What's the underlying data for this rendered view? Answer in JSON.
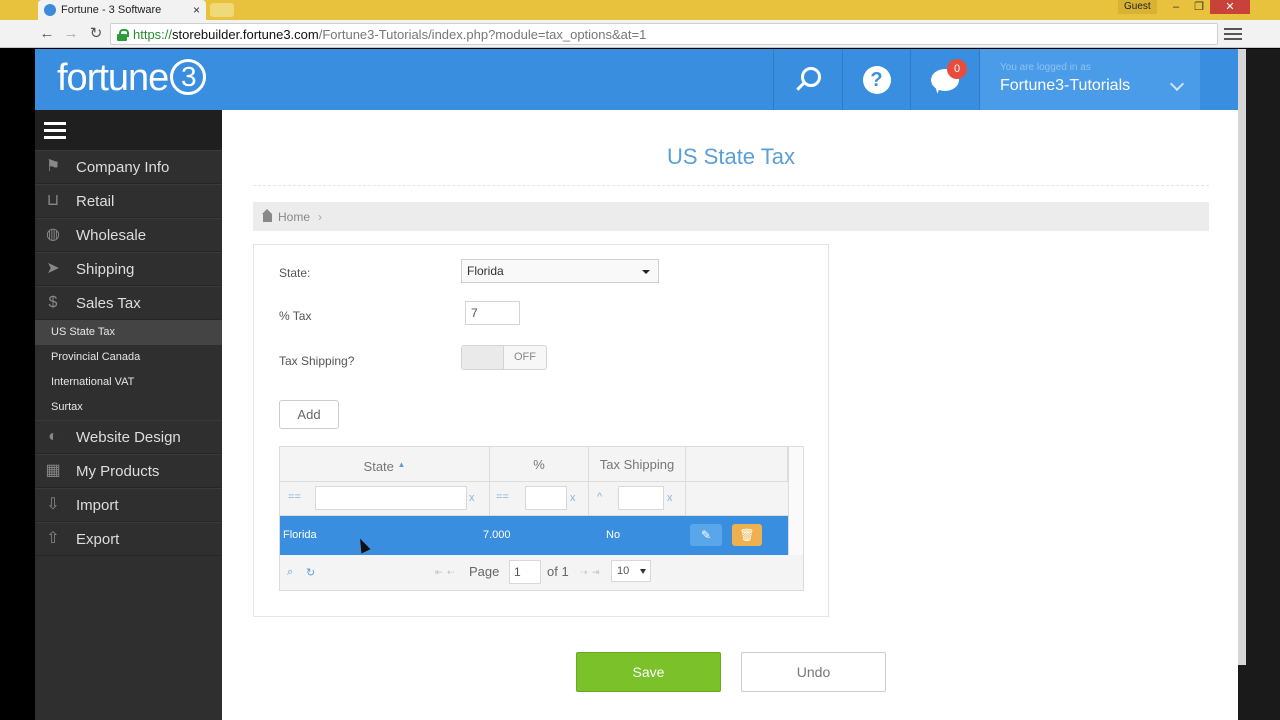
{
  "browser": {
    "tab_title": "Fortune - 3 Software",
    "tab_close": "×",
    "profile": "Guest",
    "url_scheme": "https://",
    "url_host": "storebuilder.fortune3.com",
    "url_path": "/Fortune3-Tutorials/index.php?module=tax_options&at=1",
    "back": "←",
    "forward": "→",
    "reload": "↻",
    "min": "–",
    "restore": "❐",
    "close": "✕"
  },
  "header": {
    "logo_text": "fortune",
    "logo_badge": "3",
    "notification_count": "0",
    "help_glyph": "?",
    "logged_in_label": "You are logged in as",
    "username": "Fortune3-Tutorials"
  },
  "sidebar": {
    "items": [
      {
        "label": "Company Info",
        "icon": "flag-icon",
        "glyph": "⚑"
      },
      {
        "label": "Retail",
        "icon": "basket-icon",
        "glyph": "⊔"
      },
      {
        "label": "Wholesale",
        "icon": "globe-icon",
        "glyph": "◍"
      },
      {
        "label": "Shipping",
        "icon": "send-icon",
        "glyph": "➤"
      },
      {
        "label": "Sales Tax",
        "icon": "dollar-icon",
        "glyph": "$"
      }
    ],
    "sub_items": [
      "US State Tax",
      "Provincial Canada",
      "International VAT",
      "Surtax"
    ],
    "items_bottom": [
      {
        "label": "Website Design",
        "icon": "palette-icon",
        "glyph": "◐"
      },
      {
        "label": "My Products",
        "icon": "cubes-icon",
        "glyph": "▦"
      },
      {
        "label": "Import",
        "icon": "download-icon",
        "glyph": "⇩"
      },
      {
        "label": "Export",
        "icon": "upload-icon",
        "glyph": "⇧"
      }
    ]
  },
  "page": {
    "title": "US State Tax",
    "breadcrumb_home": "Home",
    "breadcrumb_sep": "›"
  },
  "form": {
    "state_label": "State:",
    "state_value": "Florida",
    "tax_label": "% Tax",
    "tax_value": "7",
    "shipping_label": "Tax Shipping?",
    "shipping_toggle": "OFF",
    "add_label": "Add"
  },
  "grid": {
    "columns": [
      "State",
      "%",
      "Tax Shipping"
    ],
    "sort_glyph": "▲",
    "filter_ops": [
      "==",
      "==",
      "^"
    ],
    "filter_clear": "x",
    "rows": [
      {
        "state": "Florida",
        "percent": "7.000",
        "shipping": "No"
      }
    ],
    "edit_glyph": "✎",
    "delete_glyph": "🗑",
    "pager": {
      "search_glyph": "⌕",
      "refresh_glyph": "↻",
      "nav_prev": "⇤ ⇠",
      "nav_next": "⇢ ⇥",
      "page_label": "Page",
      "page_value": "1",
      "of_label": "of 1",
      "rows_per_page": "10"
    }
  },
  "actions": {
    "save": "Save",
    "undo": "Undo"
  },
  "colors": {
    "header_blue": "#3a8ee0",
    "save_green": "#7ac12a",
    "delete_orange": "#efb04f",
    "sidebar_dark": "#2f2f2f"
  }
}
